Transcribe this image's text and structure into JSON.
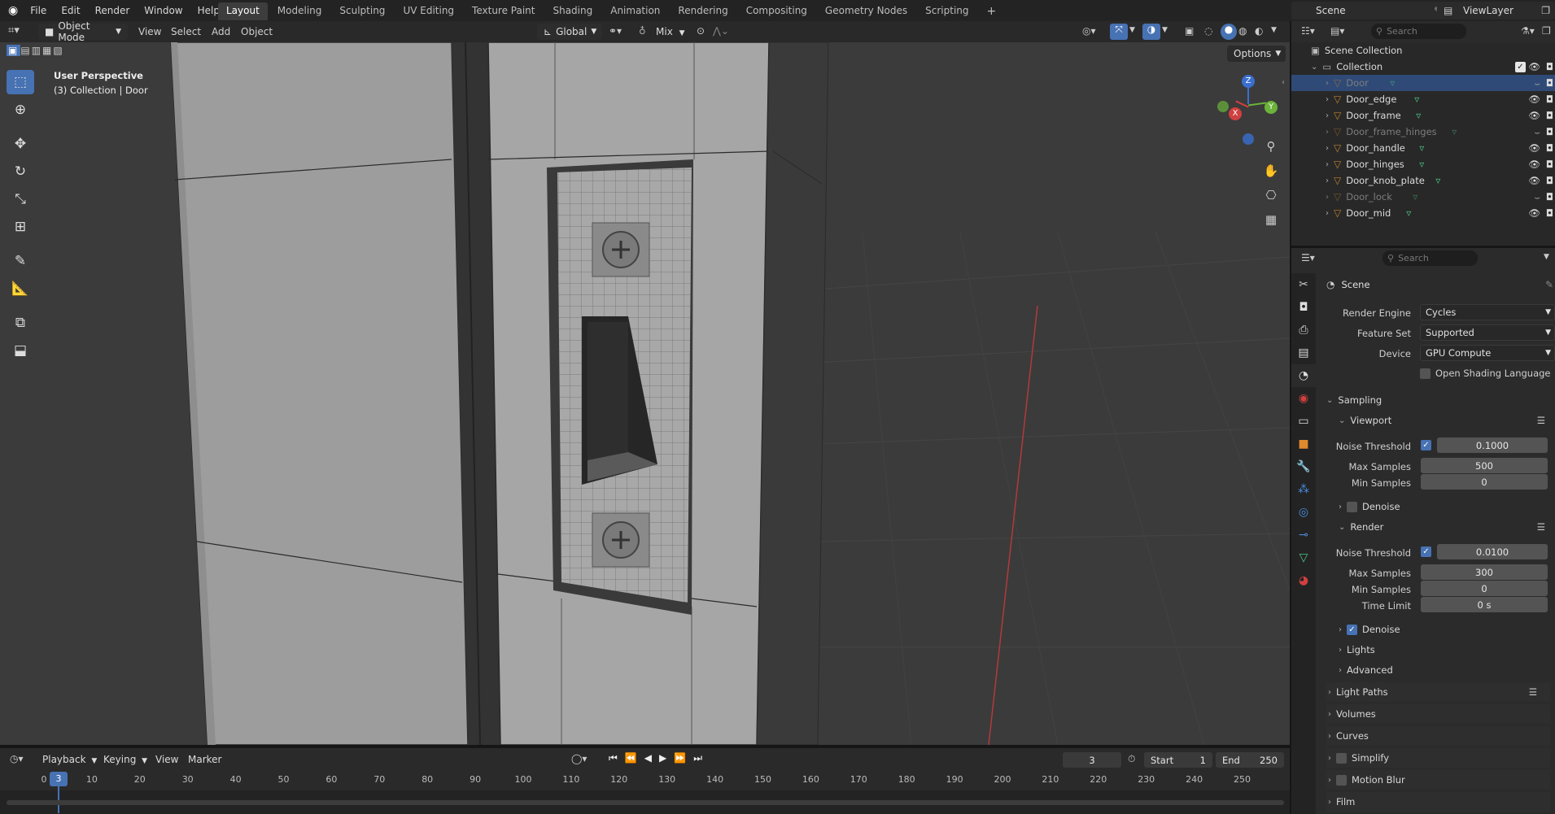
{
  "menu": [
    "File",
    "Edit",
    "Render",
    "Window",
    "Help"
  ],
  "workspaces": [
    "Layout",
    "Modeling",
    "Sculpting",
    "UV Editing",
    "Texture Paint",
    "Shading",
    "Animation",
    "Rendering",
    "Compositing",
    "Geometry Nodes",
    "Scripting"
  ],
  "active_workspace": "Layout",
  "scene_name": "Scene",
  "view_layer": "ViewLayer",
  "viewport": {
    "mode": "Object Mode",
    "menus": [
      "View",
      "Select",
      "Add",
      "Object"
    ],
    "orientation": "Global",
    "snap_mode": "Mix",
    "options_label": "Options",
    "overlay_title": "User Perspective",
    "overlay_subtitle": "(3) Collection | Door",
    "gizmo_axes": [
      "Z",
      "X",
      "Y"
    ]
  },
  "outliner": {
    "search_placeholder": "Search",
    "scene_collection": "Scene Collection",
    "collection": "Collection",
    "objects": [
      {
        "name": "Door",
        "selected": true,
        "visible": false
      },
      {
        "name": "Door_edge",
        "selected": false,
        "visible": true
      },
      {
        "name": "Door_frame",
        "selected": false,
        "visible": true
      },
      {
        "name": "Door_frame_hinges",
        "selected": false,
        "visible": false
      },
      {
        "name": "Door_handle",
        "selected": false,
        "visible": true
      },
      {
        "name": "Door_hinges",
        "selected": false,
        "visible": true
      },
      {
        "name": "Door_knob_plate",
        "selected": false,
        "visible": true
      },
      {
        "name": "Door_lock",
        "selected": false,
        "visible": false
      },
      {
        "name": "Door_mid",
        "selected": false,
        "visible": true
      }
    ]
  },
  "properties": {
    "search_placeholder": "Search",
    "context": "Scene",
    "render_engine_label": "Render Engine",
    "render_engine": "Cycles",
    "feature_set_label": "Feature Set",
    "feature_set": "Supported",
    "device_label": "Device",
    "device": "GPU Compute",
    "osl_label": "Open Shading Language",
    "sampling": "Sampling",
    "viewport": {
      "title": "Viewport",
      "noise_threshold_label": "Noise Threshold",
      "noise_threshold": "0.1000",
      "max_samples_label": "Max Samples",
      "max_samples": "500",
      "min_samples_label": "Min Samples",
      "min_samples": "0",
      "denoise_label": "Denoise"
    },
    "render": {
      "title": "Render",
      "noise_threshold_label": "Noise Threshold",
      "noise_threshold": "0.0100",
      "max_samples_label": "Max Samples",
      "max_samples": "300",
      "min_samples_label": "Min Samples",
      "min_samples": "0",
      "time_limit_label": "Time Limit",
      "time_limit": "0 s",
      "denoise_label": "Denoise"
    },
    "subsections": [
      "Lights",
      "Advanced"
    ],
    "sections": [
      "Light Paths",
      "Volumes",
      "Curves",
      "Simplify",
      "Motion Blur",
      "Film"
    ]
  },
  "timeline": {
    "menus": [
      "Playback",
      "Keying",
      "View",
      "Marker"
    ],
    "current_frame": "3",
    "start_label": "Start",
    "start": "1",
    "end_label": "End",
    "end": "250",
    "ticks": [
      "0",
      "10",
      "20",
      "30",
      "40",
      "50",
      "60",
      "70",
      "80",
      "90",
      "100",
      "110",
      "120",
      "130",
      "140",
      "150",
      "160",
      "170",
      "180",
      "190",
      "200",
      "210",
      "220",
      "230",
      "240",
      "250"
    ]
  }
}
